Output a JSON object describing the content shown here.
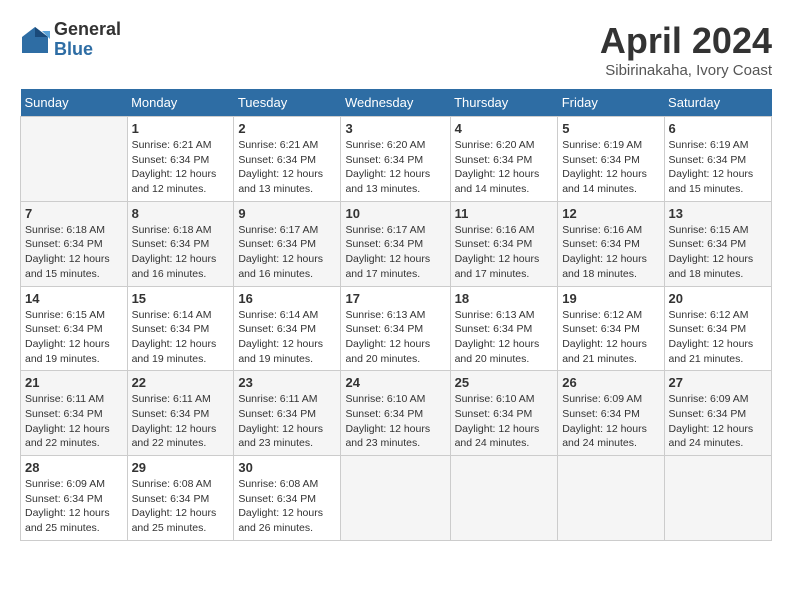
{
  "header": {
    "logo_general": "General",
    "logo_blue": "Blue",
    "month_title": "April 2024",
    "location": "Sibirinakaha, Ivory Coast"
  },
  "calendar": {
    "days_of_week": [
      "Sunday",
      "Monday",
      "Tuesday",
      "Wednesday",
      "Thursday",
      "Friday",
      "Saturday"
    ],
    "weeks": [
      [
        {
          "day": "",
          "sunrise": "",
          "sunset": "",
          "daylight": ""
        },
        {
          "day": "1",
          "sunrise": "Sunrise: 6:21 AM",
          "sunset": "Sunset: 6:34 PM",
          "daylight": "Daylight: 12 hours and 12 minutes."
        },
        {
          "day": "2",
          "sunrise": "Sunrise: 6:21 AM",
          "sunset": "Sunset: 6:34 PM",
          "daylight": "Daylight: 12 hours and 13 minutes."
        },
        {
          "day": "3",
          "sunrise": "Sunrise: 6:20 AM",
          "sunset": "Sunset: 6:34 PM",
          "daylight": "Daylight: 12 hours and 13 minutes."
        },
        {
          "day": "4",
          "sunrise": "Sunrise: 6:20 AM",
          "sunset": "Sunset: 6:34 PM",
          "daylight": "Daylight: 12 hours and 14 minutes."
        },
        {
          "day": "5",
          "sunrise": "Sunrise: 6:19 AM",
          "sunset": "Sunset: 6:34 PM",
          "daylight": "Daylight: 12 hours and 14 minutes."
        },
        {
          "day": "6",
          "sunrise": "Sunrise: 6:19 AM",
          "sunset": "Sunset: 6:34 PM",
          "daylight": "Daylight: 12 hours and 15 minutes."
        }
      ],
      [
        {
          "day": "7",
          "sunrise": "Sunrise: 6:18 AM",
          "sunset": "Sunset: 6:34 PM",
          "daylight": "Daylight: 12 hours and 15 minutes."
        },
        {
          "day": "8",
          "sunrise": "Sunrise: 6:18 AM",
          "sunset": "Sunset: 6:34 PM",
          "daylight": "Daylight: 12 hours and 16 minutes."
        },
        {
          "day": "9",
          "sunrise": "Sunrise: 6:17 AM",
          "sunset": "Sunset: 6:34 PM",
          "daylight": "Daylight: 12 hours and 16 minutes."
        },
        {
          "day": "10",
          "sunrise": "Sunrise: 6:17 AM",
          "sunset": "Sunset: 6:34 PM",
          "daylight": "Daylight: 12 hours and 17 minutes."
        },
        {
          "day": "11",
          "sunrise": "Sunrise: 6:16 AM",
          "sunset": "Sunset: 6:34 PM",
          "daylight": "Daylight: 12 hours and 17 minutes."
        },
        {
          "day": "12",
          "sunrise": "Sunrise: 6:16 AM",
          "sunset": "Sunset: 6:34 PM",
          "daylight": "Daylight: 12 hours and 18 minutes."
        },
        {
          "day": "13",
          "sunrise": "Sunrise: 6:15 AM",
          "sunset": "Sunset: 6:34 PM",
          "daylight": "Daylight: 12 hours and 18 minutes."
        }
      ],
      [
        {
          "day": "14",
          "sunrise": "Sunrise: 6:15 AM",
          "sunset": "Sunset: 6:34 PM",
          "daylight": "Daylight: 12 hours and 19 minutes."
        },
        {
          "day": "15",
          "sunrise": "Sunrise: 6:14 AM",
          "sunset": "Sunset: 6:34 PM",
          "daylight": "Daylight: 12 hours and 19 minutes."
        },
        {
          "day": "16",
          "sunrise": "Sunrise: 6:14 AM",
          "sunset": "Sunset: 6:34 PM",
          "daylight": "Daylight: 12 hours and 19 minutes."
        },
        {
          "day": "17",
          "sunrise": "Sunrise: 6:13 AM",
          "sunset": "Sunset: 6:34 PM",
          "daylight": "Daylight: 12 hours and 20 minutes."
        },
        {
          "day": "18",
          "sunrise": "Sunrise: 6:13 AM",
          "sunset": "Sunset: 6:34 PM",
          "daylight": "Daylight: 12 hours and 20 minutes."
        },
        {
          "day": "19",
          "sunrise": "Sunrise: 6:12 AM",
          "sunset": "Sunset: 6:34 PM",
          "daylight": "Daylight: 12 hours and 21 minutes."
        },
        {
          "day": "20",
          "sunrise": "Sunrise: 6:12 AM",
          "sunset": "Sunset: 6:34 PM",
          "daylight": "Daylight: 12 hours and 21 minutes."
        }
      ],
      [
        {
          "day": "21",
          "sunrise": "Sunrise: 6:11 AM",
          "sunset": "Sunset: 6:34 PM",
          "daylight": "Daylight: 12 hours and 22 minutes."
        },
        {
          "day": "22",
          "sunrise": "Sunrise: 6:11 AM",
          "sunset": "Sunset: 6:34 PM",
          "daylight": "Daylight: 12 hours and 22 minutes."
        },
        {
          "day": "23",
          "sunrise": "Sunrise: 6:11 AM",
          "sunset": "Sunset: 6:34 PM",
          "daylight": "Daylight: 12 hours and 23 minutes."
        },
        {
          "day": "24",
          "sunrise": "Sunrise: 6:10 AM",
          "sunset": "Sunset: 6:34 PM",
          "daylight": "Daylight: 12 hours and 23 minutes."
        },
        {
          "day": "25",
          "sunrise": "Sunrise: 6:10 AM",
          "sunset": "Sunset: 6:34 PM",
          "daylight": "Daylight: 12 hours and 24 minutes."
        },
        {
          "day": "26",
          "sunrise": "Sunrise: 6:09 AM",
          "sunset": "Sunset: 6:34 PM",
          "daylight": "Daylight: 12 hours and 24 minutes."
        },
        {
          "day": "27",
          "sunrise": "Sunrise: 6:09 AM",
          "sunset": "Sunset: 6:34 PM",
          "daylight": "Daylight: 12 hours and 24 minutes."
        }
      ],
      [
        {
          "day": "28",
          "sunrise": "Sunrise: 6:09 AM",
          "sunset": "Sunset: 6:34 PM",
          "daylight": "Daylight: 12 hours and 25 minutes."
        },
        {
          "day": "29",
          "sunrise": "Sunrise: 6:08 AM",
          "sunset": "Sunset: 6:34 PM",
          "daylight": "Daylight: 12 hours and 25 minutes."
        },
        {
          "day": "30",
          "sunrise": "Sunrise: 6:08 AM",
          "sunset": "Sunset: 6:34 PM",
          "daylight": "Daylight: 12 hours and 26 minutes."
        },
        {
          "day": "",
          "sunrise": "",
          "sunset": "",
          "daylight": ""
        },
        {
          "day": "",
          "sunrise": "",
          "sunset": "",
          "daylight": ""
        },
        {
          "day": "",
          "sunrise": "",
          "sunset": "",
          "daylight": ""
        },
        {
          "day": "",
          "sunrise": "",
          "sunset": "",
          "daylight": ""
        }
      ]
    ]
  }
}
